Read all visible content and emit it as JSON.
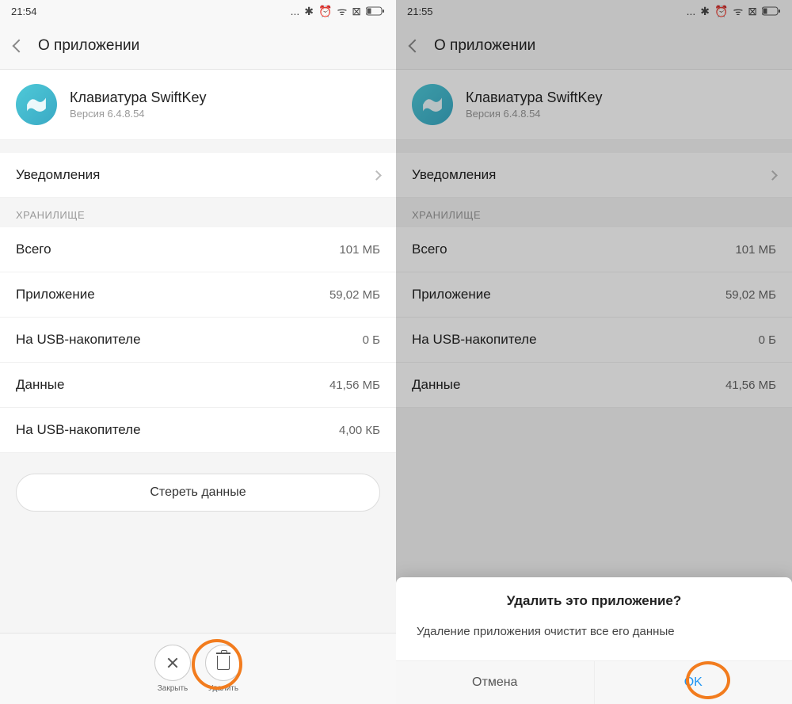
{
  "left": {
    "time": "21:54",
    "nav_title": "О приложении",
    "app_name": "Клавиатура SwiftKey",
    "app_version": "Версия 6.4.8.54",
    "notifications": "Уведомления",
    "storage_header": "ХРАНИЛИЩЕ",
    "rows": [
      {
        "label": "Всего",
        "value": "101 МБ"
      },
      {
        "label": "Приложение",
        "value": "59,02 МБ"
      },
      {
        "label": "На USB-накопителе",
        "value": "0 Б"
      },
      {
        "label": "Данные",
        "value": "41,56 МБ"
      },
      {
        "label": "На USB-накопителе",
        "value": "4,00 КБ"
      }
    ],
    "clear_data": "Стереть данные",
    "close": "Закрыть",
    "delete": "Удалить"
  },
  "right": {
    "time": "21:55",
    "nav_title": "О приложении",
    "app_name": "Клавиатура SwiftKey",
    "app_version": "Версия 6.4.8.54",
    "notifications": "Уведомления",
    "storage_header": "ХРАНИЛИЩЕ",
    "rows": [
      {
        "label": "Всего",
        "value": "101 МБ"
      },
      {
        "label": "Приложение",
        "value": "59,02 МБ"
      },
      {
        "label": "На USB-накопителе",
        "value": "0 Б"
      },
      {
        "label": "Данные",
        "value": "41,56 МБ"
      }
    ],
    "dialog": {
      "title": "Удалить это приложение?",
      "message": "Удаление приложения очистит все его данные",
      "cancel": "Отмена",
      "ok": "OK"
    }
  },
  "status_icons": "... ✱ ⏰ ᯤ ⊠"
}
